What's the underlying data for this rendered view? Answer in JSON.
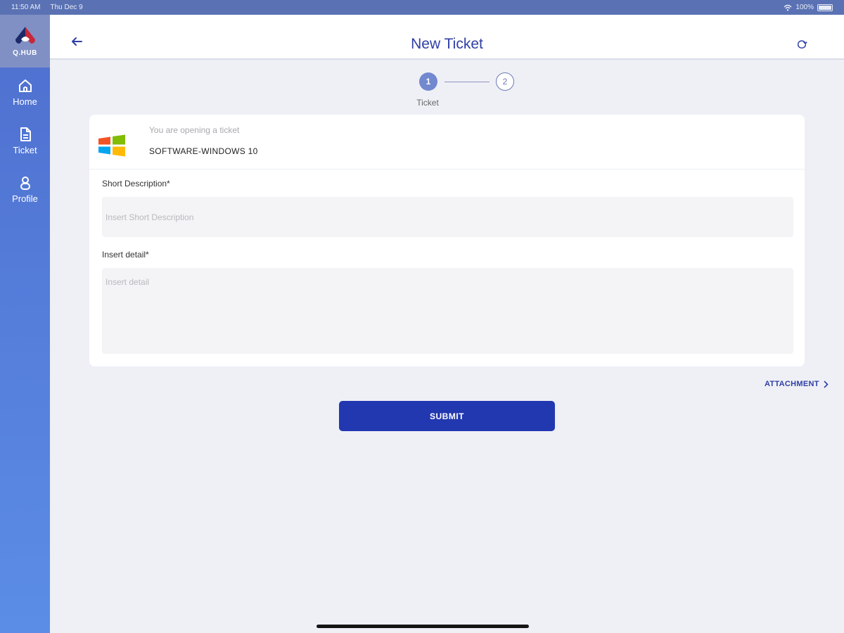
{
  "status_bar": {
    "time": "11:50 AM",
    "date": "Thu Dec 9",
    "battery": "100%",
    "wifi_icon": "wifi-icon",
    "battery_icon": "battery-icon"
  },
  "sidebar": {
    "logo_label": "Q.HUB",
    "items": [
      {
        "label": "Home",
        "icon": "home-icon"
      },
      {
        "label": "Ticket",
        "icon": "document-icon"
      },
      {
        "label": "Profile",
        "icon": "profile-icon"
      }
    ]
  },
  "header": {
    "title": "New Ticket",
    "back_icon": "arrow-left-icon",
    "refresh_icon": "refresh-icon"
  },
  "stepper": {
    "steps": [
      "1",
      "2"
    ],
    "active_label": "Ticket",
    "active_step": 1
  },
  "ticket": {
    "intro": "You are opening a ticket",
    "category": "SOFTWARE-WINDOWS 10",
    "category_icon": "windows-logo-icon"
  },
  "form": {
    "short_description": {
      "label": "Short Description*",
      "placeholder": "Insert Short Description",
      "value": ""
    },
    "detail": {
      "label": "Insert detail*",
      "placeholder": "Insert detail",
      "value": ""
    }
  },
  "actions": {
    "attachment_label": "ATTACHMENT",
    "submit_label": "SUBMIT"
  },
  "colors": {
    "primary": "#2238b0",
    "title": "#2f3fa6",
    "sidebar": "#5b8de6",
    "status_bar": "#5a72b4",
    "background": "#eff0f6"
  }
}
